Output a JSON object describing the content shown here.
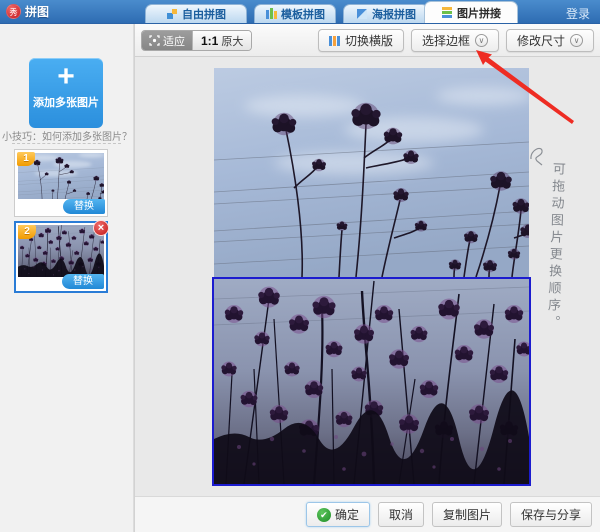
{
  "header": {
    "logo_text": "拼图",
    "login_label": "登录",
    "tabs": [
      {
        "label": "自由拼图",
        "active": false
      },
      {
        "label": "模板拼图",
        "active": false
      },
      {
        "label": "海报拼图",
        "active": false
      },
      {
        "label": "图片拼接",
        "active": true
      }
    ]
  },
  "sidebar": {
    "add_label": "添加多张图片",
    "tip_text": "小技巧：如何添加多张图片？",
    "thumbnails": [
      {
        "index": "1",
        "replace_label": "替换",
        "selected": false,
        "closable": false
      },
      {
        "index": "2",
        "replace_label": "替换",
        "selected": true,
        "closable": true
      }
    ]
  },
  "toolbar": {
    "fit_label": "适应",
    "zoom_ratio": "1:1",
    "zoom_original": "原大",
    "switch_label": "切换横版",
    "border_label": "选择边框",
    "resize_label": "修改尺寸"
  },
  "canvas": {
    "annotation": "可拖动图片更换顺序。",
    "selection_color": "#1c1ccf",
    "arrow_color": "#ee2c23"
  },
  "footer": {
    "confirm_label": "确定",
    "cancel_label": "取消",
    "copy_label": "复制图片",
    "save_label": "保存与分享"
  },
  "icons": {
    "logo_glyph": "秀",
    "plus": "+",
    "check": "✔",
    "close": "×",
    "chevron_down": "∨"
  },
  "colors": {
    "header_blue": "#2e6cb2",
    "accent_blue": "#2b8fdd",
    "badge_orange": "#f29b00",
    "tab_text_blue": "#1b5e9e"
  }
}
